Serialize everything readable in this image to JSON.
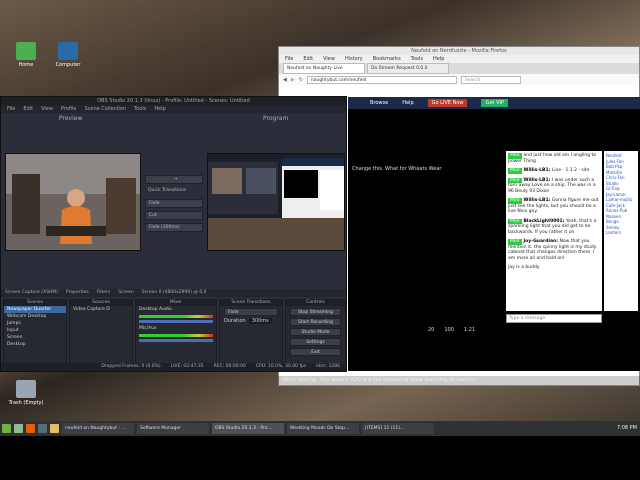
{
  "desktop": {
    "icons": [
      {
        "label": "Home",
        "color": "#4caf50"
      },
      {
        "label": "Computer",
        "color": "#2b6aa8"
      },
      {
        "label": "Trash (Empty)",
        "color": "#9aa5b1"
      }
    ]
  },
  "obs": {
    "title": "OBS Studio 20.1.3 (linux) - Profile: Untitled - Scenes: Untitled",
    "menu": [
      "File",
      "Edit",
      "View",
      "Profile",
      "Scene Collection",
      "Tools",
      "Help"
    ],
    "preview_label": "Preview",
    "program_label": "Program",
    "transition": {
      "quick_label": "Quick Transitions",
      "items": [
        "Fade",
        "Cut",
        "Fade (300ms)"
      ]
    },
    "source_bar": [
      "Screen Capture (XSHM)",
      "Properties",
      "Filters",
      "Screen",
      "Screen 0 (4800x2990) @ 0,0"
    ],
    "scenes": {
      "title": "Scenes",
      "items": [
        "Newspaper Quarter",
        "Webcam Desktop",
        "Jumps",
        "Input",
        "Screen",
        "Desktop"
      ]
    },
    "sources": {
      "title": "Sources",
      "items": [
        "Video Capture D"
      ]
    },
    "mixer": {
      "title": "Mixer",
      "channels": [
        "Desktop Audio",
        "Mic/Aux"
      ]
    },
    "transitions_dock": {
      "title": "Scene Transitions",
      "value": "Fade",
      "duration_label": "Duration",
      "duration": "300ms"
    },
    "controls": {
      "title": "Controls",
      "buttons": [
        "Stop Streaming",
        "Start Recording",
        "Studio Mode",
        "Settings",
        "Exit"
      ]
    },
    "status": [
      "Dropped Frames: 0 (0.0%)",
      "LIVE: 02:47:35",
      "REC: 00:00:00",
      "CPU: 10.0%, 30.00 fps",
      "kb/s: 1286"
    ]
  },
  "firefox": {
    "title": "Neufeld on Nerdfuzzle - Mozilla Firefox",
    "menu": [
      "File",
      "Edit",
      "View",
      "History",
      "Bookmarks",
      "Tools",
      "Help"
    ],
    "tabs": [
      "Neufeld on Naughty Live",
      "Do Stream Request 0.0.0"
    ],
    "url": "naughtybut.com/neufeld",
    "search_placeholder": "Search",
    "site_nav": {
      "browse": "Browse",
      "help": "Help",
      "go_live": "Go LIVE Now",
      "vip": "Get VIP"
    },
    "video_caption": "Change this. What for Wheats Wear",
    "video_stats": {
      "viewers": "20",
      "likes": "100",
      "time": "1:21"
    },
    "chat": [
      {
        "tag": "Mod",
        "name": "",
        "text": "and just how old am I angling to power Thing"
      },
      {
        "tag": "Mod",
        "name": "Willis-LB1:",
        "text": "Live - 1.1.2 - site"
      },
      {
        "tag": "Mod",
        "name": "Willis-LB1:",
        "text": "I was under such a torn away Love on a ship. The was in a 96 Beuly 93 Dixon"
      },
      {
        "tag": "Mod",
        "name": "Willis-LB1:",
        "text": "Gonna figure me out just see the lights, but you should be a live Nice guy."
      },
      {
        "tag": "Mod",
        "name": "BlackLight0001:",
        "text": "Yeah, that's a sparkling light that you did get to be backwards. If you rather it on"
      },
      {
        "tag": "Mod",
        "name": "Joy-Guardian:",
        "text": "Now that you mention it, the spinny light is my study cabinet that changes direction there. I am more all and hold on!"
      },
      {
        "tag": "",
        "name": "",
        "text": "Jay is a buddy"
      }
    ],
    "chat_placeholder": "Type a message",
    "users": [
      "Neufeld",
      "Jules-Fan",
      "Bob-Pop",
      "Mark4ie",
      "Chris-Fan",
      "Studio",
      "Gr-Trop",
      "Jay-Lamar",
      "Lamar-mojito",
      "Cafe-Jack",
      "Annes-Pub",
      "Nazeen",
      "Bongo",
      "Smiley",
      "Lantern"
    ],
    "info_strip": "We're playing. This week's VOD is a live streaming show featuring all manner"
  },
  "taskbar": {
    "apps": [
      "neufeld on Naughtybut - ...",
      "Software Manager",
      "OBS Studio 20.1.3 - Pro...",
      "Wedding Moods Do Stop...",
      "[ITEMS] 11 (11)..."
    ],
    "active_index": 2,
    "clock": "7:08 PM"
  },
  "colors": {
    "obs_bg": "#2b2e38",
    "site_nav": "#1b2a4a",
    "live_red": "#c0392b",
    "vip_green": "#27ae60"
  }
}
